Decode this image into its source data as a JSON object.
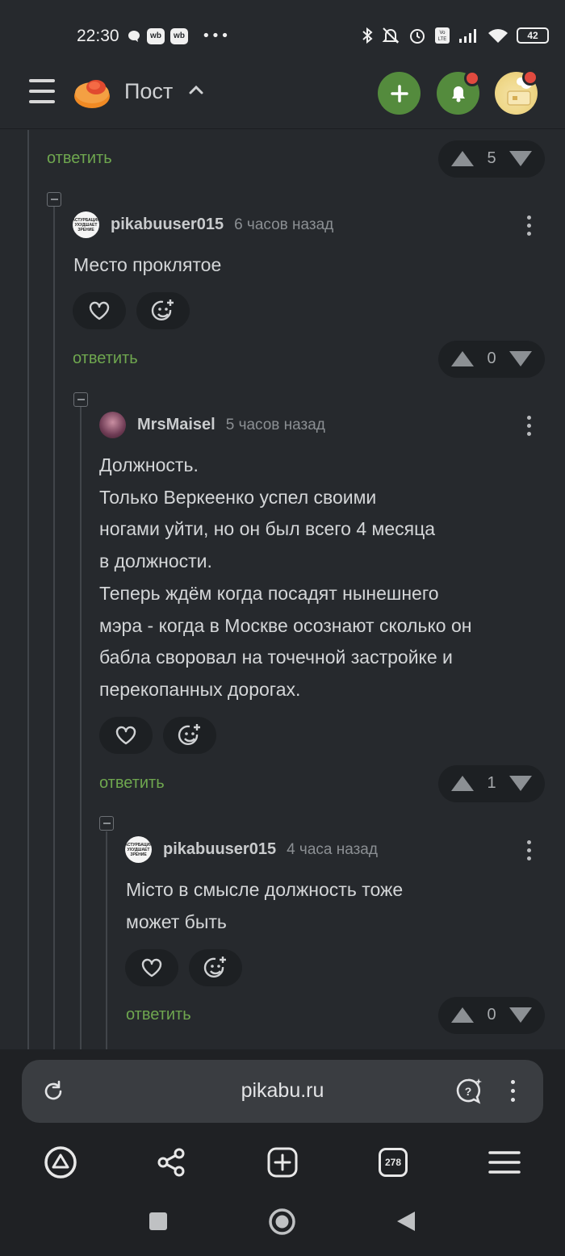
{
  "status_bar": {
    "time": "22:30",
    "wb1": "wb",
    "wb2": "wb",
    "more": "•••",
    "battery": "42",
    "icons": [
      "chat-bubble-icon",
      "bluetooth-icon",
      "mute-icon",
      "alarm-icon",
      "volte-icon",
      "signal-icon",
      "wifi-icon",
      "battery-icon"
    ]
  },
  "header": {
    "title": "Пост",
    "accent_color": "#548b3d",
    "badge_color": "#e14a3f"
  },
  "top_actions": {
    "reply": "ответить",
    "votes": "5"
  },
  "comments": [
    {
      "author": "pikabuuser015",
      "avatar_text": "АСТУРБАЦИЯ УХУДШАЕТ ЗРЕНИЕ",
      "time": "6 часов назад",
      "text": [
        "Место проклятое"
      ],
      "reply": "ответить",
      "votes": "0"
    },
    {
      "author": "MrsMaisel",
      "time": "5 часов назад",
      "text": [
        "Должность.",
        "Только Веркеенко успел своими",
        "ногами уйти, но он был всего 4 месяца",
        "в должности.",
        "Теперь ждём когда посадят нынешнего",
        "мэра - когда в Москве осознают сколько он",
        "бабла своровал на точечной застройке и",
        "перекопанных дорогах."
      ],
      "reply": "ответить",
      "votes": "1"
    },
    {
      "author": "pikabuuser015",
      "avatar_text": "АСТУРБАЦИЯ УХУДШАЕТ ЗРЕНИЕ",
      "time": "4 часа назад",
      "text": [
        "Мiсто в смысле должность тоже",
        "может быть"
      ],
      "reply": "ответить",
      "votes": "0"
    }
  ],
  "browser": {
    "url": "pikabu.ru",
    "tab_count": "278"
  }
}
